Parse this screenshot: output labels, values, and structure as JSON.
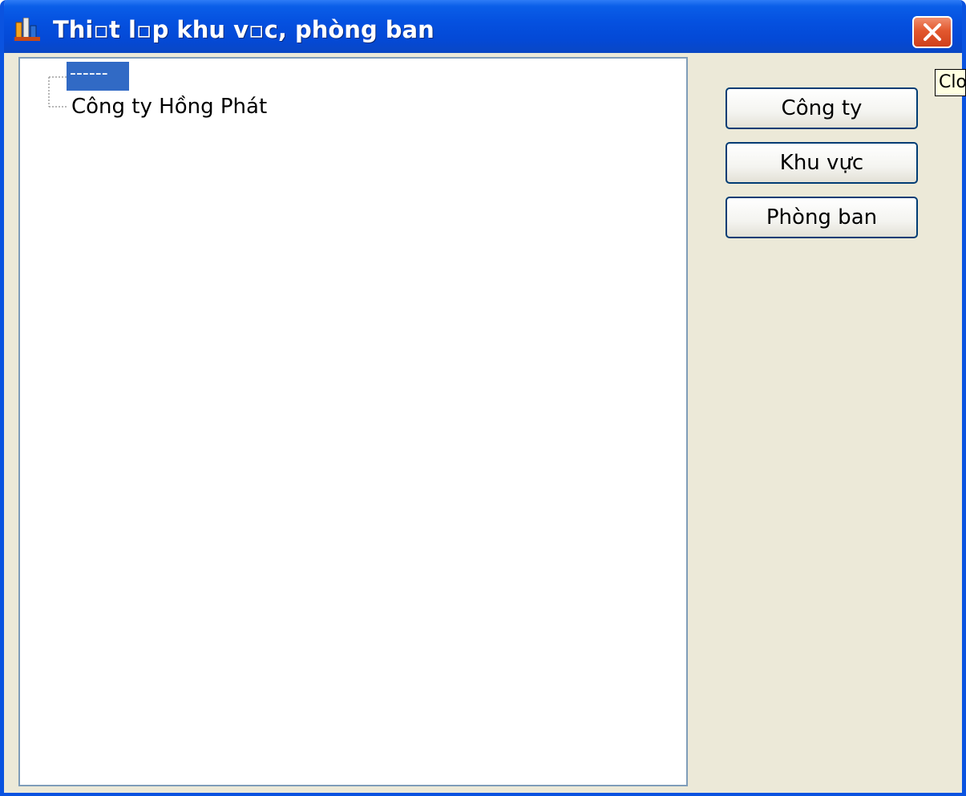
{
  "window": {
    "title": "Thi▫t l▫p khu v▫c, phòng ban",
    "app_icon": "chart-app-icon",
    "close_icon": "close-icon"
  },
  "tree": {
    "items": [
      {
        "label": "------",
        "selected": true
      },
      {
        "label": "Công ty Hồng Phát",
        "selected": false
      }
    ]
  },
  "buttons": {
    "company": "Công ty",
    "region": "Khu vực",
    "department": "Phòng ban"
  },
  "tooltip": {
    "text": "Close"
  },
  "colors": {
    "titlebar": "#0551e0",
    "selection": "#316ac5",
    "close_button": "#e2582e",
    "dialog_background": "#ece9d8"
  }
}
